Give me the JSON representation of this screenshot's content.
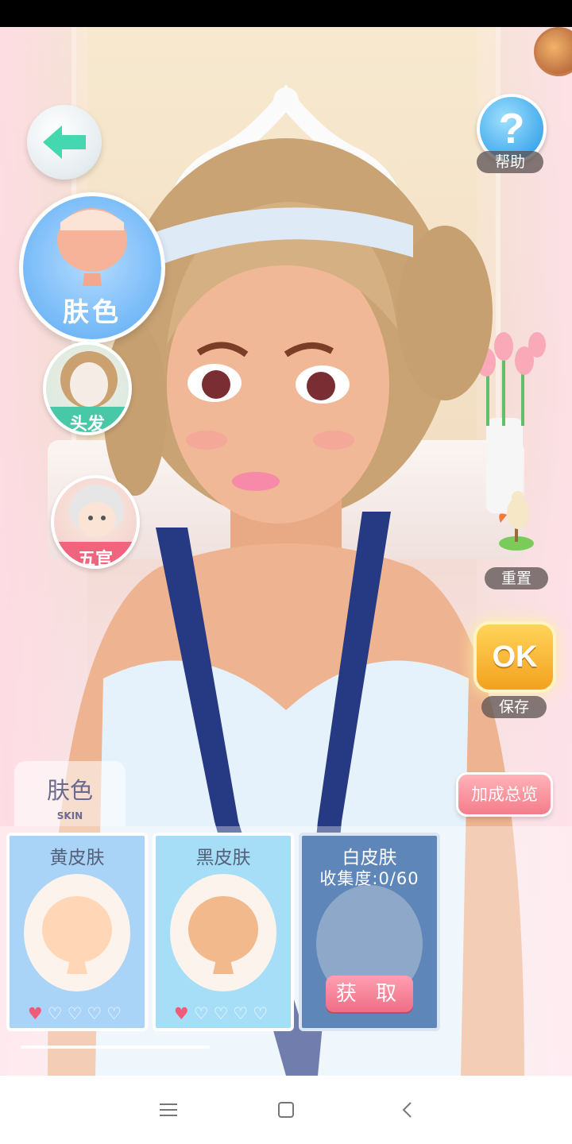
{
  "header": {
    "help_label": "帮助",
    "help_glyph": "?"
  },
  "categories": {
    "skin": "肤色",
    "hair": "头发",
    "features": "五官"
  },
  "actions": {
    "reset_label": "重置",
    "ok_label": "OK",
    "save_label": "保存",
    "bonus_label": "加成总览"
  },
  "tab": {
    "title": "肤色",
    "subtitle": "SKIN"
  },
  "items": [
    {
      "name": "黄皮肤",
      "hearts_filled": 1,
      "hearts_total": 5,
      "bg": "#a9d3f7",
      "face": "#ffd7b6"
    },
    {
      "name": "黑皮肤",
      "hearts_filled": 1,
      "hearts_total": 5,
      "bg": "#a7def7",
      "face": "#f2b98c"
    },
    {
      "name": "白皮肤",
      "collect_text": "收集度:0/60",
      "obtain_label": "获 取",
      "locked": true
    }
  ],
  "colors": {
    "accent_pink": "#f37d8a",
    "skin_blue": "#6bb4f6",
    "locked_card": "#5e86b8"
  },
  "icons": {
    "back": "arrow-left-icon",
    "help": "question-icon",
    "reset": "bird-toy-icon",
    "nav": [
      "menu-icon",
      "home-square-icon",
      "back-chevron-icon"
    ]
  }
}
